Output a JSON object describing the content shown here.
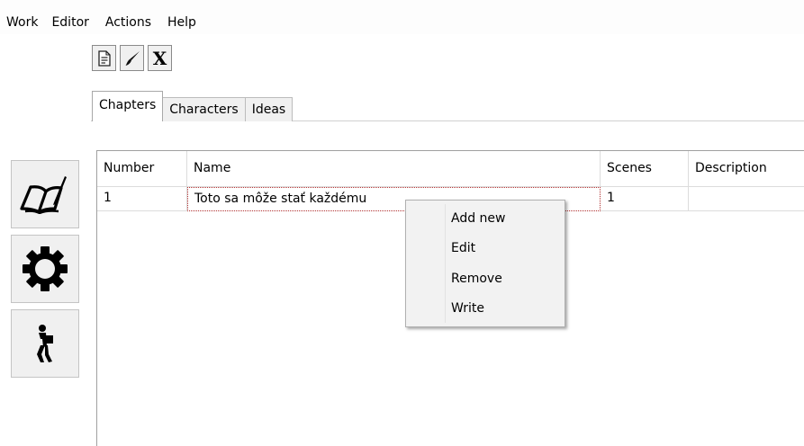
{
  "menu": [
    "Work",
    "Editor",
    "Actions",
    "Help"
  ],
  "toolbar": {
    "buttons": [
      {
        "icon": "document-icon"
      },
      {
        "icon": "brush-icon"
      },
      {
        "icon": "close-x-icon",
        "label": "X"
      }
    ]
  },
  "sidebar": {
    "buttons": [
      {
        "icon": "open-book-icon"
      },
      {
        "icon": "gear-icon"
      },
      {
        "icon": "person-carrying-box-icon"
      }
    ]
  },
  "tabs": [
    "Chapters",
    "Characters",
    "Ideas"
  ],
  "table": {
    "columns": [
      "Number",
      "Name",
      "Scenes",
      "Description"
    ],
    "rows": [
      {
        "number": "1",
        "name": "Toto sa môže stať každému",
        "scenes": "1",
        "description": ""
      }
    ]
  },
  "context_menu": [
    "Add new",
    "Edit",
    "Remove",
    "Write"
  ]
}
